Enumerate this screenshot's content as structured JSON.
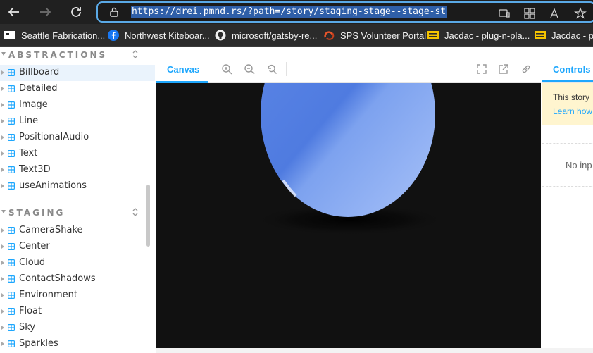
{
  "browser": {
    "url": "https://drei.pmnd.rs/?path=/story/staging-stage--stage-st",
    "bookmarks": [
      {
        "label": "Seattle Fabrication...",
        "icon": "seattle-fab-favicon"
      },
      {
        "label": "Northwest Kiteboar...",
        "icon": "facebook-favicon"
      },
      {
        "label": "microsoft/gatsby-re...",
        "icon": "github-favicon"
      },
      {
        "label": "SPS Volunteer Portal",
        "icon": "sps-favicon"
      },
      {
        "label": "Jacdac - plug-n-pla...",
        "icon": "jacdac-favicon"
      },
      {
        "label": "Jacdac - plu",
        "icon": "jacdac-favicon"
      }
    ]
  },
  "sidebar": {
    "sections": [
      {
        "title": "ABSTRACTIONS",
        "items": [
          "Billboard",
          "Detailed",
          "Image",
          "Line",
          "PositionalAudio",
          "Text",
          "Text3D",
          "useAnimations"
        ]
      },
      {
        "title": "STAGING",
        "items": [
          "CameraShake",
          "Center",
          "Cloud",
          "ContactShadows",
          "Environment",
          "Float",
          "Sky",
          "Sparkles"
        ]
      }
    ],
    "active_item": "Billboard"
  },
  "canvas": {
    "tab_label": "Canvas"
  },
  "controls": {
    "tab_label": "Controls",
    "notice_line1": "This story",
    "notice_link": "Learn how",
    "empty_text": "No inp"
  },
  "colors": {
    "accent": "#1ea7fd",
    "sphere": "#4f7be0",
    "stage_bg": "#111111",
    "notice_bg": "#fff5cf"
  }
}
